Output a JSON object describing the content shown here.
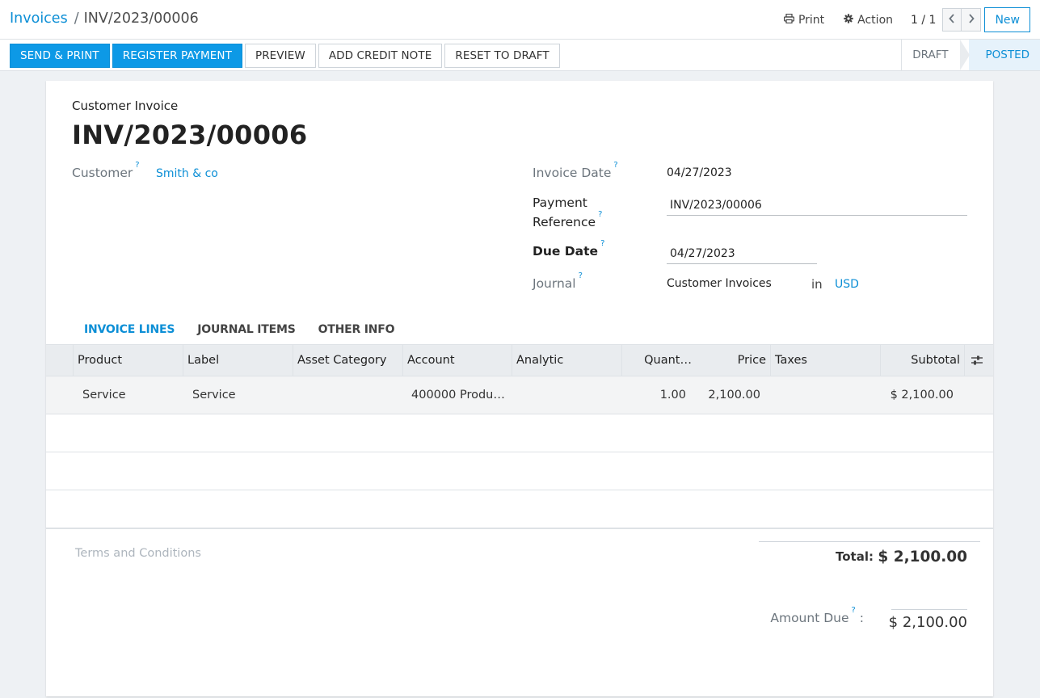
{
  "breadcrumb": {
    "parent": "Invoices",
    "separator": "/",
    "current": "INV/2023/00006"
  },
  "toolbar": {
    "print_label": "Print",
    "action_label": "Action",
    "pager": "1 / 1",
    "new_label": "New"
  },
  "actions": [
    "SEND & PRINT",
    "REGISTER PAYMENT",
    "PREVIEW",
    "ADD CREDIT NOTE",
    "RESET TO DRAFT"
  ],
  "states": {
    "draft": "DRAFT",
    "posted": "POSTED",
    "current": "POSTED"
  },
  "invoice": {
    "kind": "Customer Invoice",
    "name": "INV/2023/00006",
    "customer_label": "Customer",
    "customer": "Smith & co",
    "invoice_date_label": "Invoice Date",
    "invoice_date": "04/27/2023",
    "payment_reference_label_1": "Payment",
    "payment_reference_label_2": "Reference",
    "payment_reference": "INV/2023/00006",
    "due_date_label": "Due Date",
    "due_date": "04/27/2023",
    "journal_label": "Journal",
    "journal": "Customer Invoices",
    "journal_in": "in",
    "currency": "USD",
    "help_mark": "?"
  },
  "tabs": [
    "INVOICE LINES",
    "JOURNAL ITEMS",
    "OTHER INFO"
  ],
  "lines": {
    "columns": [
      "Product",
      "Label",
      "Asset Category",
      "Account",
      "Analytic",
      "Quant…",
      "Price",
      "Taxes",
      "Subtotal"
    ],
    "rows": [
      {
        "product": "Service",
        "label": "Service",
        "asset_category": "",
        "account": "400000 Produ…",
        "analytic": "",
        "quantity": "1.00",
        "price": "2,100.00",
        "taxes": "",
        "subtotal": "$ 2,100.00"
      }
    ]
  },
  "footer": {
    "terms_placeholder": "Terms and Conditions",
    "total_label": "Total:",
    "total": "$ 2,100.00",
    "amount_due_label": "Amount Due",
    "amount_due_colon": ":",
    "amount_due": "$ 2,100.00"
  },
  "colors": {
    "accent": "#0d8fd6",
    "primary_button": "#0d99e6",
    "posted_state_bg": "#e6f2fb"
  },
  "icons": {
    "print": "printer-icon",
    "action": "gear-icon",
    "prev": "chevron-left-icon",
    "next": "chevron-right-icon",
    "column_settings": "sliders-icon"
  }
}
